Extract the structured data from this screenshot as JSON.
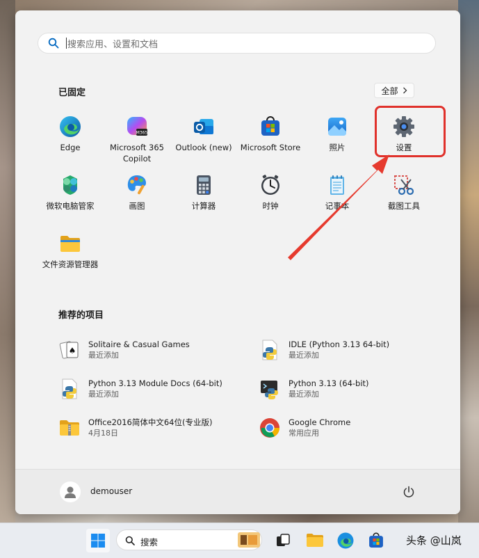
{
  "search": {
    "placeholder": "搜索应用、设置和文档"
  },
  "pinned": {
    "title": "已固定",
    "all_label": "全部",
    "apps": [
      {
        "label": "Edge"
      },
      {
        "label": "Microsoft 365\nCopilot"
      },
      {
        "label": "Outlook (new)"
      },
      {
        "label": "Microsoft Store"
      },
      {
        "label": "照片"
      },
      {
        "label": "设置"
      },
      {
        "label": "微软电脑管家"
      },
      {
        "label": "画图"
      },
      {
        "label": "计算器"
      },
      {
        "label": "时钟"
      },
      {
        "label": "记事本"
      },
      {
        "label": "截图工具"
      },
      {
        "label": "文件资源管理器"
      }
    ]
  },
  "recommended": {
    "title": "推荐的项目",
    "items": [
      {
        "name": "Solitaire & Casual Games",
        "sub": "最近添加"
      },
      {
        "name": "IDLE (Python 3.13 64-bit)",
        "sub": "最近添加"
      },
      {
        "name": "Python 3.13 Module Docs (64-bit)",
        "sub": "最近添加"
      },
      {
        "name": "Python 3.13 (64-bit)",
        "sub": "最近添加"
      },
      {
        "name": "Office2016简体中文64位(专业版)",
        "sub": "4月18日"
      },
      {
        "name": "Google Chrome",
        "sub": "常用应用"
      }
    ]
  },
  "user": {
    "name": "demouser"
  },
  "taskbar": {
    "search_label": "搜索"
  },
  "watermark": "头条 @山岚",
  "colors": {
    "highlight": "#e0312b",
    "accent": "#0067c0"
  }
}
